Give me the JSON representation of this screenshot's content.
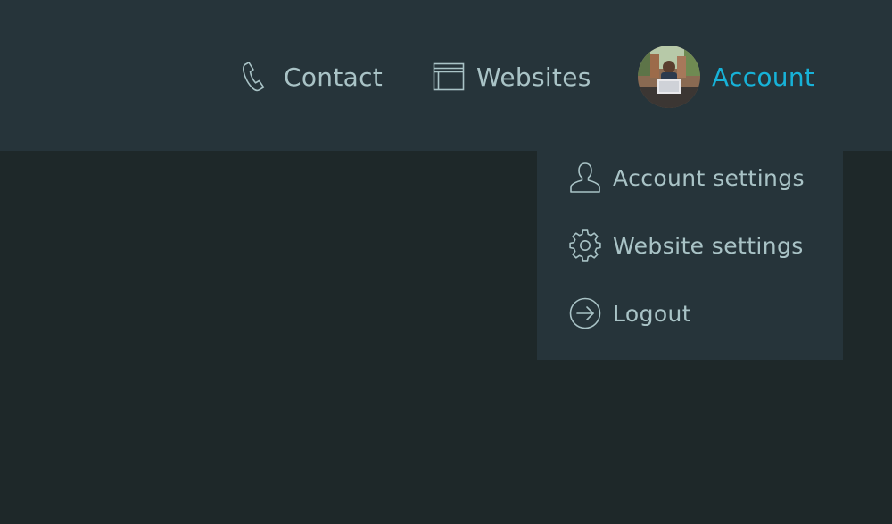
{
  "nav": {
    "contact_label": "Contact",
    "websites_label": "Websites",
    "account_label": "Account"
  },
  "account_menu": {
    "items": [
      {
        "label": "Account settings",
        "icon": "user-icon"
      },
      {
        "label": "Website settings",
        "icon": "gear-icon"
      },
      {
        "label": "Logout",
        "icon": "logout-icon"
      }
    ]
  },
  "colors": {
    "header_bg": "#26343a",
    "page_bg": "#1e2829",
    "text": "#a9c3c6",
    "accent": "#17b2d8"
  }
}
